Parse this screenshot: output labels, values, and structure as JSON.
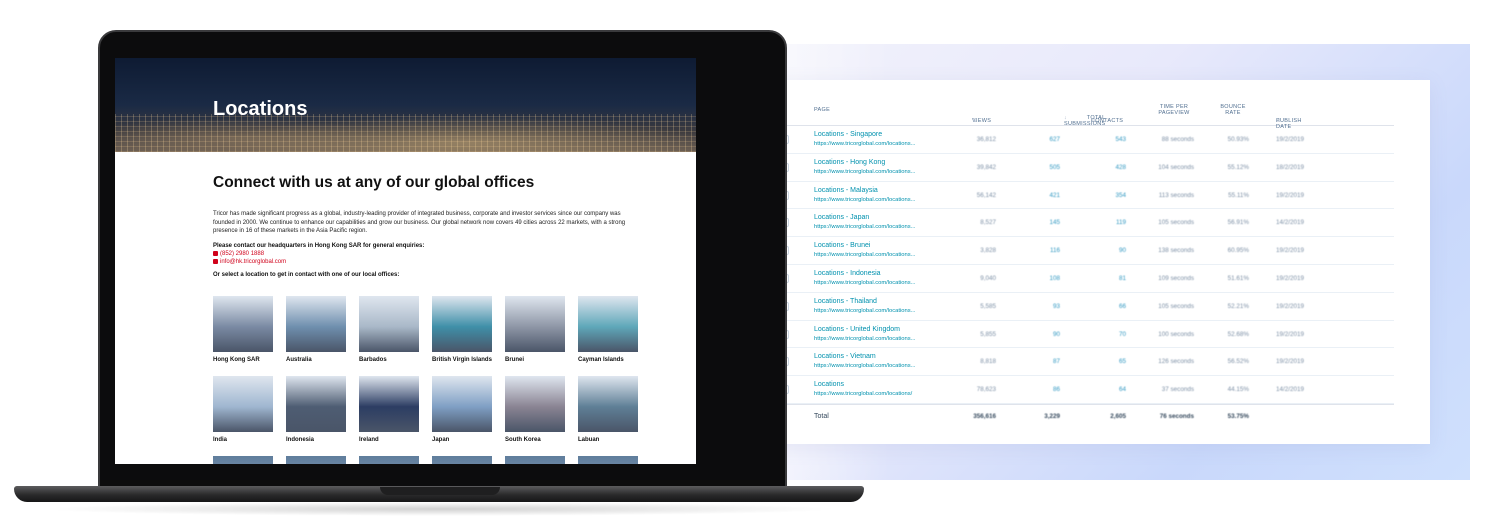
{
  "website": {
    "hero_title": "Locations",
    "heading": "Connect with us at any of our global offices",
    "intro": "Tricor has made significant progress as a global, industry-leading provider of integrated business, corporate and investor services since our company was founded in 2000. We continue to enhance our capabilities and grow our business. Our global network now covers 49 cities across 22 markets, with a strong presence in 16 of these markets in the Asia Pacific region.",
    "hq_prompt": "Please contact our headquarters in Hong Kong SAR for general enquiries:",
    "phone": "(852) 2980 1888",
    "email": "info@hk.tricorglobal.com",
    "select_prompt": "Or select a location to get in contact with one of our local offices:",
    "locations": [
      {
        "name": "Hong Kong SAR",
        "color": "#7a8aa3"
      },
      {
        "name": "Australia",
        "color": "#6f8fae"
      },
      {
        "name": "Barbados",
        "color": "#a9b8c8"
      },
      {
        "name": "British Virgin Islands",
        "color": "#3f8fa8"
      },
      {
        "name": "Brunei",
        "color": "#8e96a6"
      },
      {
        "name": "Cayman Islands",
        "color": "#5fa7b9"
      },
      {
        "name": "India",
        "color": "#9fb6d0"
      },
      {
        "name": "Indonesia",
        "color": "#4e5d73"
      },
      {
        "name": "Ireland",
        "color": "#2c3d63"
      },
      {
        "name": "Japan",
        "color": "#7f9fc4"
      },
      {
        "name": "South Korea",
        "color": "#8a8493"
      },
      {
        "name": "Labuan",
        "color": "#5f7f96"
      }
    ]
  },
  "analytics": {
    "headers": {
      "page": "PAGE",
      "views": "VIEWS",
      "submissions": "TOTAL SUBMISSIONS",
      "contacts": "CONTACTS",
      "time": "TIME PER PAGEVIEW",
      "bounce": "BOUNCE RATE",
      "date": "PUBLISH DATE"
    },
    "rows": [
      {
        "page": "Locations - Singapore",
        "url": "https://www.tricorglobal.com/locations...",
        "views": "36,812",
        "submissions": "627",
        "contacts": "543",
        "time": "88 seconds",
        "bounce": "50.93%",
        "date": "19/2/2019"
      },
      {
        "page": "Locations - Hong Kong",
        "url": "https://www.tricorglobal.com/locations...",
        "views": "39,842",
        "submissions": "505",
        "contacts": "428",
        "time": "104 seconds",
        "bounce": "55.12%",
        "date": "18/2/2019"
      },
      {
        "page": "Locations - Malaysia",
        "url": "https://www.tricorglobal.com/locations...",
        "views": "56,142",
        "submissions": "421",
        "contacts": "354",
        "time": "113 seconds",
        "bounce": "55.11%",
        "date": "19/2/2019"
      },
      {
        "page": "Locations - Japan",
        "url": "https://www.tricorglobal.com/locations...",
        "views": "8,527",
        "submissions": "145",
        "contacts": "119",
        "time": "105 seconds",
        "bounce": "56.91%",
        "date": "14/2/2019"
      },
      {
        "page": "Locations - Brunei",
        "url": "https://www.tricorglobal.com/locations...",
        "views": "3,828",
        "submissions": "116",
        "contacts": "90",
        "time": "138 seconds",
        "bounce": "60.95%",
        "date": "19/2/2019"
      },
      {
        "page": "Locations - Indonesia",
        "url": "https://www.tricorglobal.com/locations...",
        "views": "9,040",
        "submissions": "108",
        "contacts": "81",
        "time": "109 seconds",
        "bounce": "51.61%",
        "date": "19/2/2019"
      },
      {
        "page": "Locations - Thailand",
        "url": "https://www.tricorglobal.com/locations...",
        "views": "5,585",
        "submissions": "93",
        "contacts": "66",
        "time": "105 seconds",
        "bounce": "52.21%",
        "date": "19/2/2019"
      },
      {
        "page": "Locations - United Kingdom",
        "url": "https://www.tricorglobal.com/locations...",
        "views": "5,855",
        "submissions": "90",
        "contacts": "70",
        "time": "100 seconds",
        "bounce": "52.68%",
        "date": "19/2/2019"
      },
      {
        "page": "Locations - Vietnam",
        "url": "https://www.tricorglobal.com/locations...",
        "views": "8,818",
        "submissions": "87",
        "contacts": "65",
        "time": "126 seconds",
        "bounce": "56.52%",
        "date": "19/2/2019"
      },
      {
        "page": "Locations",
        "url": "https://www.tricorglobal.com/locations/",
        "views": "78,623",
        "submissions": "86",
        "contacts": "64",
        "time": "37 seconds",
        "bounce": "44.15%",
        "date": "14/2/2019"
      }
    ],
    "total": {
      "label": "Total",
      "views": "356,616",
      "submissions": "3,229",
      "contacts": "2,605",
      "time": "76 seconds",
      "bounce": "53.75%"
    }
  }
}
